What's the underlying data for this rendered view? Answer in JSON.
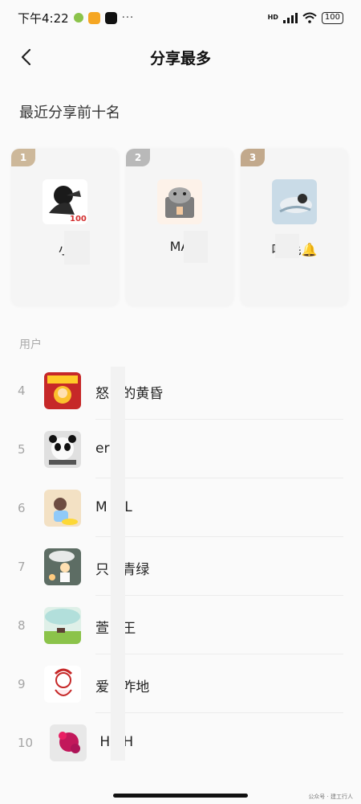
{
  "status_bar": {
    "time": "下午4:22",
    "dots": "···",
    "signal_label": "HD",
    "battery": "100"
  },
  "header": {
    "title": "分享最多"
  },
  "section_title": "最近分享前十名",
  "top_three": [
    {
      "rank": "1",
      "name": "小",
      "tag_color": "#cdb89a"
    },
    {
      "rank": "2",
      "name": "MA",
      "tag_color": "#b9b9b9"
    },
    {
      "rank": "3",
      "name": "哆      毛🔔",
      "tag_color": "#c2a98c"
    }
  ],
  "users_label": "用户",
  "users": [
    {
      "rank": "4",
      "name": "怒   的黄昏"
    },
    {
      "rank": "5",
      "name": "er"
    },
    {
      "rank": "6",
      "name": "M   .L"
    },
    {
      "rank": "7",
      "name": "只   青绿"
    },
    {
      "rank": "8",
      "name": "萱   王"
    },
    {
      "rank": "9",
      "name": "爱   咋地"
    },
    {
      "rank": "10",
      "name": " H   H"
    }
  ],
  "watermark": "公众号 · 建工行人"
}
